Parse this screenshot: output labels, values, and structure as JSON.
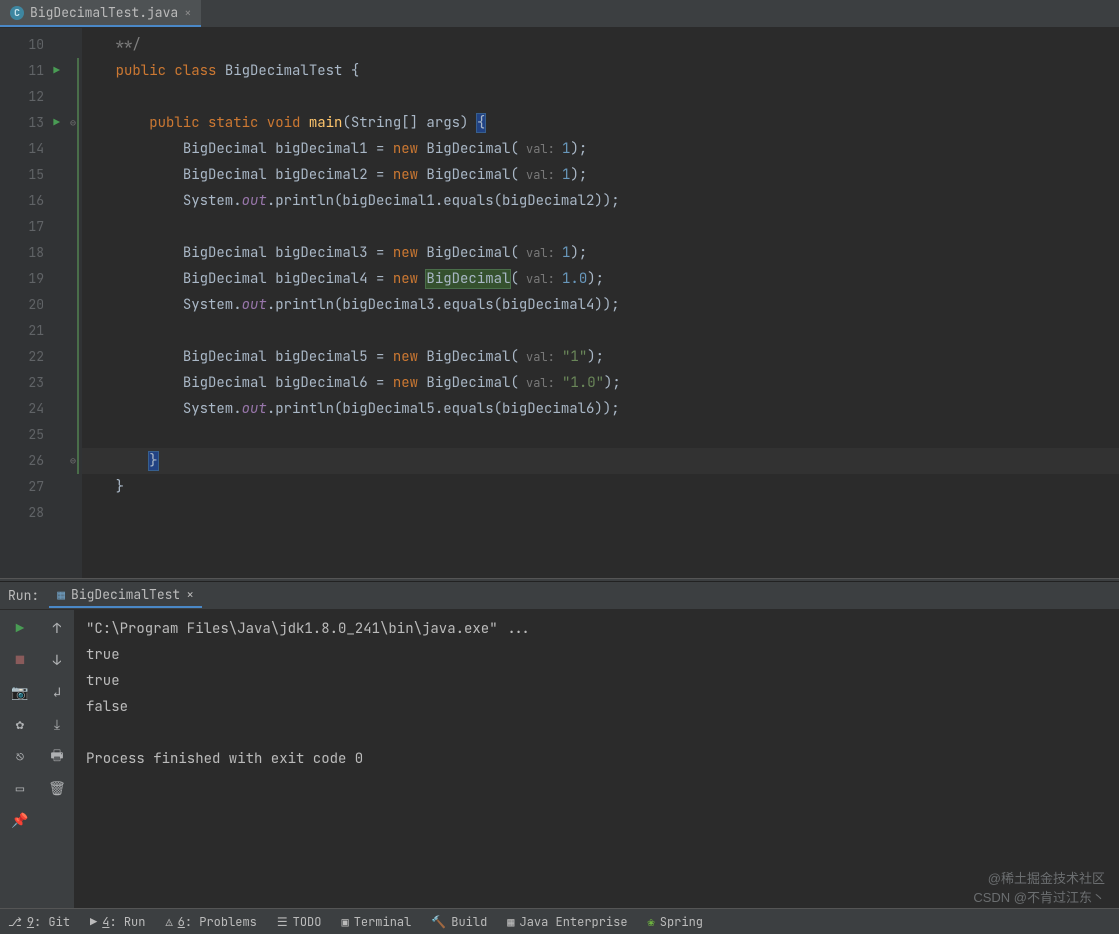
{
  "tabs": {
    "file": "BigDecimalTest.java",
    "icon_letter": "C"
  },
  "gutter": {
    "lines": [
      "10",
      "11",
      "12",
      "13",
      "14",
      "15",
      "16",
      "17",
      "18",
      "19",
      "20",
      "21",
      "22",
      "23",
      "24",
      "25",
      "26",
      "27",
      "28"
    ],
    "run_arrows": [
      11,
      13
    ],
    "fold_open": [
      13
    ],
    "fold_close": [
      26
    ]
  },
  "code": {
    "l10": "**/",
    "l11": {
      "kw1": "public class",
      "cls": "BigDecimalTest",
      "brace": " {"
    },
    "l13": {
      "kw1": "public static void ",
      "fn": "main",
      "params": "(String[] args) ",
      "brace": "{"
    },
    "l14": {
      "type": "BigDecimal bigDecimal1 = ",
      "kw": "new",
      "ctor": " BigDecimal(",
      "hint": " val: ",
      "val": "1",
      "end": ");"
    },
    "l15": {
      "type": "BigDecimal bigDecimal2 = ",
      "kw": "new",
      "ctor": " BigDecimal(",
      "hint": " val: ",
      "val": "1",
      "end": ");"
    },
    "l16": {
      "sys": "System.",
      "out": "out",
      "rest": ".println(bigDecimal1.equals(bigDecimal2));"
    },
    "l18": {
      "type": "BigDecimal bigDecimal3 = ",
      "kw": "new",
      "ctor": " BigDecimal(",
      "hint": " val: ",
      "val": "1",
      "end": ");"
    },
    "l19": {
      "type": "BigDecimal bigDecimal4 = ",
      "kw": "new",
      "ctor_a": " ",
      "ctor_sel": "BigDecimal",
      "ctor_b": "(",
      "hint": " val: ",
      "val": "1.0",
      "end": ");"
    },
    "l20": {
      "sys": "System.",
      "out": "out",
      "rest": ".println(bigDecimal3.equals(bigDecimal4));"
    },
    "l22": {
      "type": "BigDecimal bigDecimal5 = ",
      "kw": "new",
      "ctor": " BigDecimal(",
      "hint": " val: ",
      "str": "\"1\"",
      "end": ");"
    },
    "l23": {
      "type": "BigDecimal bigDecimal6 = ",
      "kw": "new",
      "ctor": " BigDecimal(",
      "hint": " val: ",
      "str": "\"1.0\"",
      "end": ");"
    },
    "l24": {
      "sys": "System.",
      "out": "out",
      "rest": ".println(bigDecimal5.equals(bigDecimal6));"
    },
    "l26": "}",
    "l27": "}"
  },
  "run": {
    "label": "Run:",
    "tab_name": "BigDecimalTest",
    "console": [
      "\"C:\\Program Files\\Java\\jdk1.8.0_241\\bin\\java.exe\" ...",
      "true",
      "true",
      "false",
      "",
      "Process finished with exit code 0"
    ]
  },
  "bottom": {
    "git": {
      "key": "9",
      "label": ": Git"
    },
    "run": {
      "key": "4",
      "label": ": Run"
    },
    "problems": {
      "key": "6",
      "label": ": Problems"
    },
    "todo": "TODO",
    "terminal": "Terminal",
    "build": "Build",
    "enterprise": "Java Enterprise",
    "spring": "Spring"
  },
  "watermark": {
    "l1": "@稀土掘金技术社区",
    "l2": "CSDN @不肯过江东丶"
  }
}
